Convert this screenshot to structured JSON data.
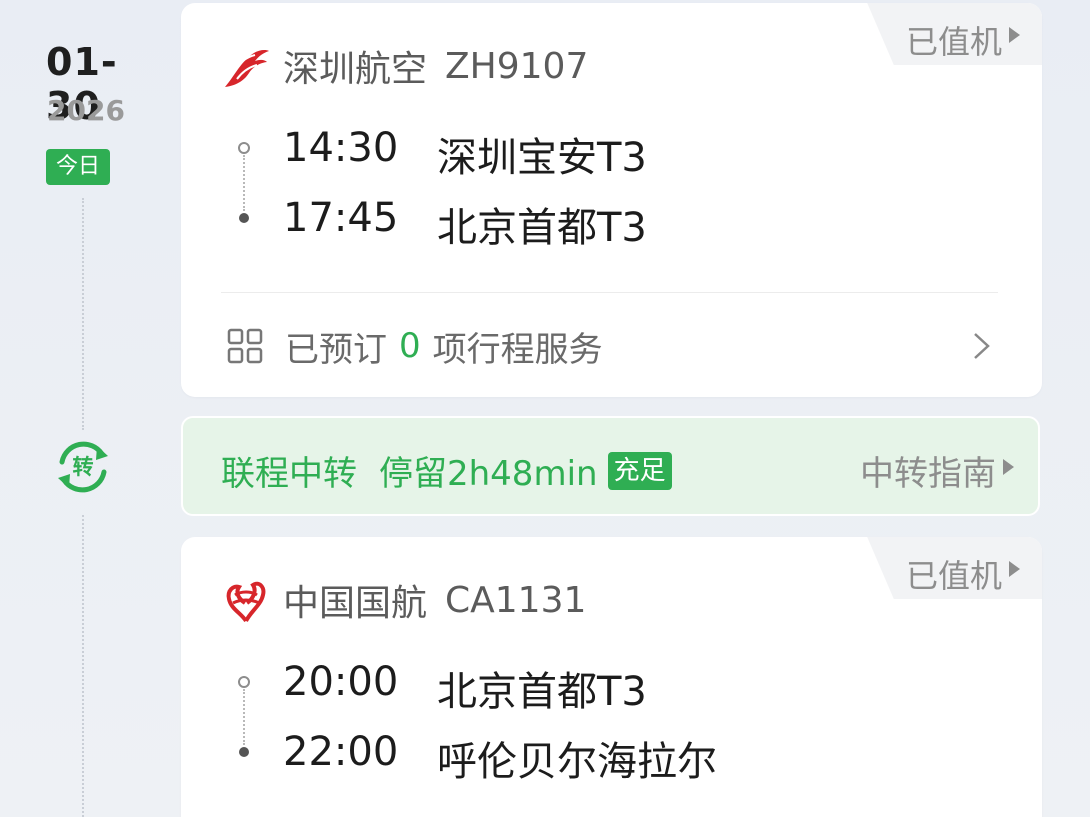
{
  "date": {
    "month_day": "01-30",
    "year": "2026",
    "today_label": "今日"
  },
  "transfer_icon_label": "转",
  "flights": [
    {
      "status": "已值机",
      "airline": "深圳航空",
      "flight_no": "ZH9107",
      "departure": {
        "time": "14:30",
        "airport": "深圳宝安T3"
      },
      "arrival": {
        "time": "17:45",
        "airport": "北京首都T3"
      },
      "services": {
        "prefix": "已预订",
        "count": "0",
        "suffix": "项行程服务"
      }
    },
    {
      "status": "已值机",
      "airline": "中国国航",
      "flight_no": "CA1131",
      "departure": {
        "time": "20:00",
        "airport": "北京首都T3"
      },
      "arrival": {
        "time": "22:00",
        "airport": "呼伦贝尔海拉尔"
      }
    }
  ],
  "transfer": {
    "label": "联程中转",
    "stay": "停留2h48min",
    "badge": "充足",
    "guide": "中转指南"
  },
  "colors": {
    "accent_green": "#2fae53",
    "transfer_bg": "#e6f4e8",
    "airline_red": "#d7262b"
  }
}
